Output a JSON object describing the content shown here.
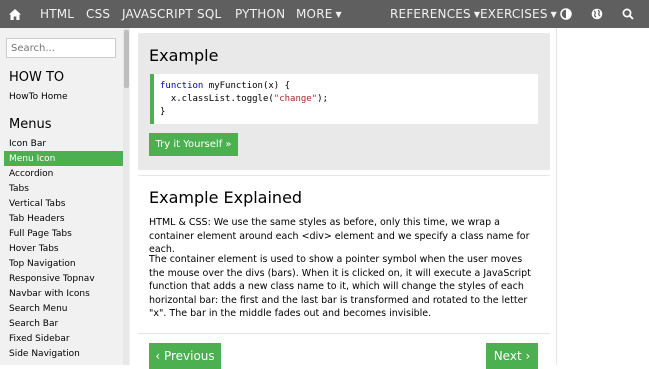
{
  "nav": {
    "html": "HTML",
    "css": "CSS",
    "javascript": "JAVASCRIPT",
    "sql": "SQL",
    "python": "PYTHON",
    "more": "MORE",
    "references": "REFERENCES",
    "exercises": "EXERCISES"
  },
  "sidebar": {
    "search_placeholder": "Search...",
    "howto_heading": "HOW TO",
    "howto_home": "HowTo Home",
    "menus_heading": "Menus",
    "items": [
      {
        "label": "Icon Bar"
      },
      {
        "label": "Menu Icon"
      },
      {
        "label": "Accordion"
      },
      {
        "label": "Tabs"
      },
      {
        "label": "Vertical Tabs"
      },
      {
        "label": "Tab Headers"
      },
      {
        "label": "Full Page Tabs"
      },
      {
        "label": "Hover Tabs"
      },
      {
        "label": "Top Navigation"
      },
      {
        "label": "Responsive Topnav"
      },
      {
        "label": "Navbar with Icons"
      },
      {
        "label": "Search Menu"
      },
      {
        "label": "Search Bar"
      },
      {
        "label": "Fixed Sidebar"
      },
      {
        "label": "Side Navigation"
      }
    ],
    "active_item": "Menu Icon"
  },
  "example": {
    "title": "Example",
    "code_line1_kw": "function",
    "code_line1_rest": " myFunction(x) {",
    "code_line2_pre": "  x.classList.toggle(",
    "code_line2_str": "\"change\"",
    "code_line2_post": ");",
    "code_line3": "}",
    "try_button": "Try it Yourself »"
  },
  "explained": {
    "title": "Example Explained",
    "para1": "HTML & CSS: We use the same styles as before, only this time, we wrap a container element around each <div> element and we specify a class name for each.",
    "para2": "The container element is used to show a pointer symbol when the user moves the mouse over the divs (bars). When it is clicked on, it will execute a JavaScript function that adds a new class name to it, which will change the styles of each horizontal bar: the first and the last bar is transformed and rotated to the letter \"x\". The bar in the middle fades out and becomes invisible."
  },
  "pager": {
    "previous": "‹ Previous",
    "next": "Next ›"
  },
  "colors": {
    "accent": "#4caf50",
    "topnav": "#5f5f5f",
    "sidebar": "#f1f1f1"
  }
}
